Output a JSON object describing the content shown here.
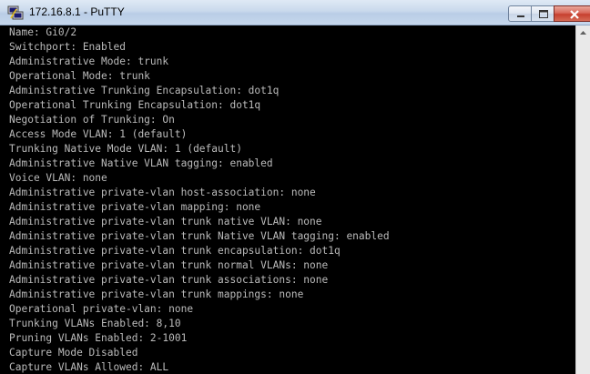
{
  "window": {
    "title": "172.16.8.1 - PuTTY",
    "icon": "putty-icon",
    "controls": [
      "minimize-icon",
      "maximize-icon",
      "close-icon"
    ]
  },
  "terminal": {
    "lines": [
      "Name: Gi0/2",
      "Switchport: Enabled",
      "Administrative Mode: trunk",
      "Operational Mode: trunk",
      "Administrative Trunking Encapsulation: dot1q",
      "Operational Trunking Encapsulation: dot1q",
      "Negotiation of Trunking: On",
      "Access Mode VLAN: 1 (default)",
      "Trunking Native Mode VLAN: 1 (default)",
      "Administrative Native VLAN tagging: enabled",
      "Voice VLAN: none",
      "Administrative private-vlan host-association: none",
      "Administrative private-vlan mapping: none",
      "Administrative private-vlan trunk native VLAN: none",
      "Administrative private-vlan trunk Native VLAN tagging: enabled",
      "Administrative private-vlan trunk encapsulation: dot1q",
      "Administrative private-vlan trunk normal VLANs: none",
      "Administrative private-vlan trunk associations: none",
      "Administrative private-vlan trunk mappings: none",
      "Operational private-vlan: none",
      "Trunking VLANs Enabled: 8,10",
      "Pruning VLANs Enabled: 2-1001",
      "Capture Mode Disabled",
      "Capture VLANs Allowed: ALL"
    ]
  },
  "colors": {
    "terminal_bg": "#000000",
    "terminal_fg": "#bbbbbb",
    "close_button": "#c7402f"
  }
}
